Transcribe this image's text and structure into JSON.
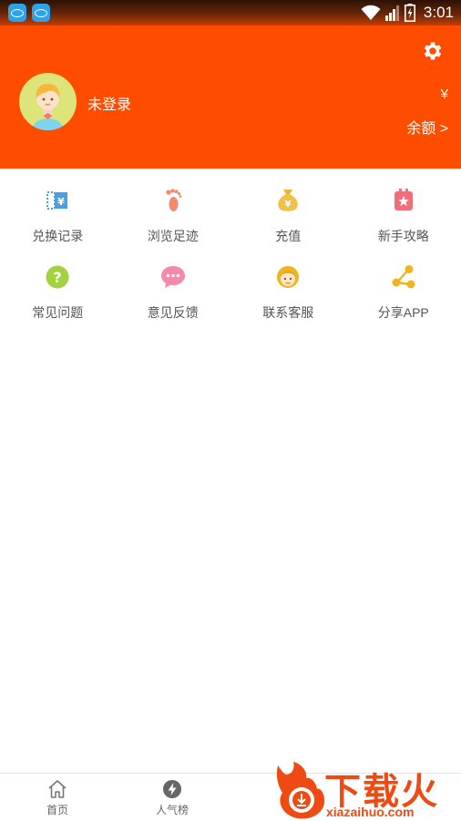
{
  "status_bar": {
    "time": "3:01",
    "apps": [
      "app-icon",
      "app-icon"
    ],
    "icons": [
      "wifi-icon",
      "signal-icon",
      "battery-icon"
    ]
  },
  "header": {
    "login_text": "未登录",
    "currency_symbol": "¥",
    "balance_label": "余额 >",
    "background_color": "#ff4d00",
    "settings_icon": "gear-icon"
  },
  "grid": {
    "rows": [
      [
        {
          "label": "兑换记录",
          "icon": "ticket-icon",
          "color": "#4a9fe0"
        },
        {
          "label": "浏览足迹",
          "icon": "footprint-icon",
          "color": "#ef8a6a"
        },
        {
          "label": "充值",
          "icon": "money-bag-icon",
          "color": "#e8b53a"
        },
        {
          "label": "新手攻略",
          "icon": "guide-icon",
          "color": "#ef6f7a"
        }
      ],
      [
        {
          "label": "常见问题",
          "icon": "question-icon",
          "color": "#a3d240"
        },
        {
          "label": "意见反馈",
          "icon": "chat-icon",
          "color": "#f58aa8"
        },
        {
          "label": "联系客服",
          "icon": "service-icon",
          "color": "#f0b41c"
        },
        {
          "label": "分享APP",
          "icon": "share-icon",
          "color": "#f0b41c"
        }
      ]
    ]
  },
  "bottom_nav": {
    "items": [
      {
        "label": "首页",
        "icon": "home-icon"
      },
      {
        "label": "人气榜",
        "icon": "lightning-icon"
      }
    ]
  },
  "watermark": {
    "title": "下载火",
    "subtitle": "xiazaihuo.com"
  }
}
